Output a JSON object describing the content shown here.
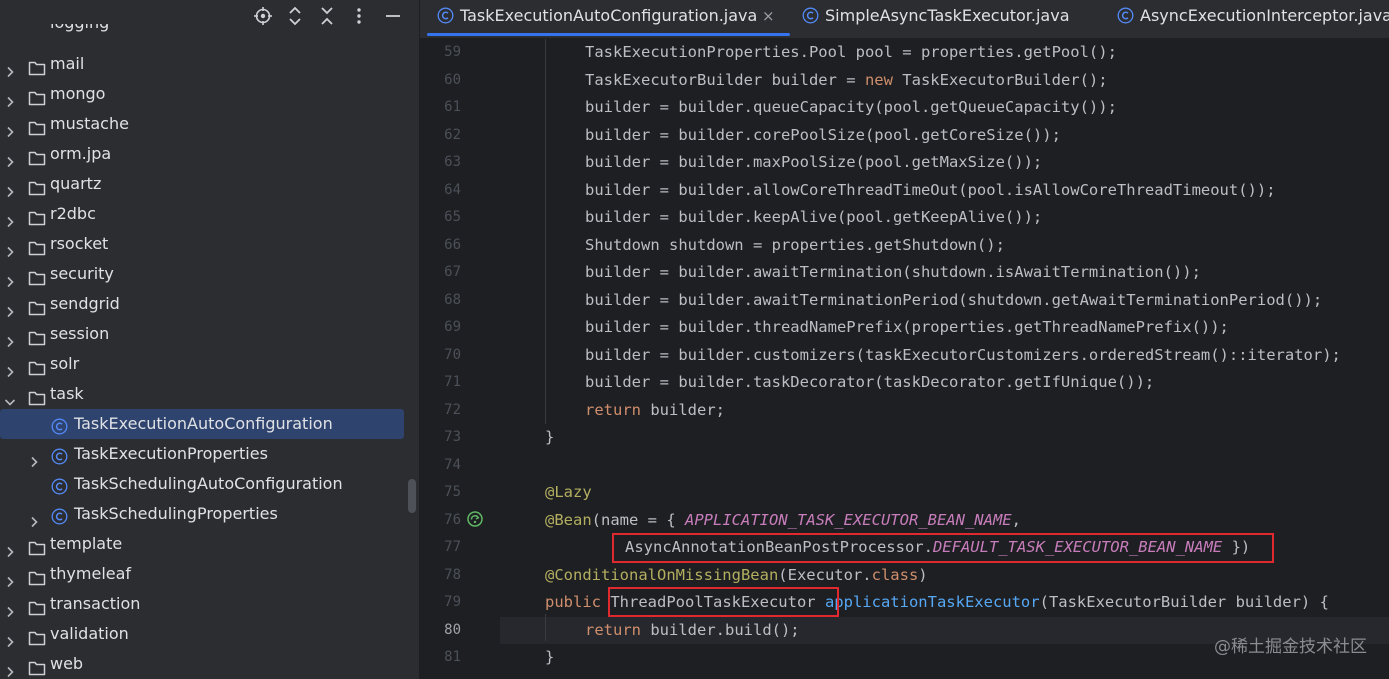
{
  "colors": {
    "panel_bg": "#2b2d30",
    "editor_bg": "#1e1f22",
    "selection_bg": "#2e436e",
    "tab_underline": "#3574f0",
    "keyword": "#cf8e6d",
    "annotation": "#b3ae60",
    "method": "#56a8f5",
    "constant": "#c77dbb",
    "highlight_box": "#e0282f"
  },
  "project_toolbar": {
    "icons": [
      "locate-icon",
      "expand-collapse-icon",
      "collapse-all-icon",
      "more-options-icon",
      "hide-icon"
    ]
  },
  "project_tree": {
    "partial_item": "logging",
    "items": [
      {
        "label": "mail",
        "type": "folder",
        "expanded": false
      },
      {
        "label": "mongo",
        "type": "folder",
        "expanded": false
      },
      {
        "label": "mustache",
        "type": "folder",
        "expanded": false
      },
      {
        "label": "orm.jpa",
        "type": "folder",
        "expanded": false
      },
      {
        "label": "quartz",
        "type": "folder",
        "expanded": false
      },
      {
        "label": "r2dbc",
        "type": "folder",
        "expanded": false
      },
      {
        "label": "rsocket",
        "type": "folder",
        "expanded": false
      },
      {
        "label": "security",
        "type": "folder",
        "expanded": false
      },
      {
        "label": "sendgrid",
        "type": "folder",
        "expanded": false
      },
      {
        "label": "session",
        "type": "folder",
        "expanded": false
      },
      {
        "label": "solr",
        "type": "folder",
        "expanded": false
      },
      {
        "label": "task",
        "type": "folder",
        "expanded": true
      },
      {
        "label": "TaskExecutionAutoConfiguration",
        "type": "class",
        "selected": true,
        "has_children": false
      },
      {
        "label": "TaskExecutionProperties",
        "type": "class",
        "has_children": true
      },
      {
        "label": "TaskSchedulingAutoConfiguration",
        "type": "class",
        "has_children": false
      },
      {
        "label": "TaskSchedulingProperties",
        "type": "class",
        "has_children": true
      },
      {
        "label": "template",
        "type": "folder",
        "expanded": false
      },
      {
        "label": "thymeleaf",
        "type": "folder",
        "expanded": false
      },
      {
        "label": "transaction",
        "type": "folder",
        "expanded": false
      },
      {
        "label": "validation",
        "type": "folder",
        "expanded": false
      },
      {
        "label": "web",
        "type": "folder",
        "expanded": false
      }
    ]
  },
  "tabs": [
    {
      "label": "TaskExecutionAutoConfiguration.java",
      "active": true,
      "close": "×"
    },
    {
      "label": "SimpleAsyncTaskExecutor.java",
      "active": false
    },
    {
      "label": "AsyncExecutionInterceptor.java",
      "active": false
    }
  ],
  "editor": {
    "current_line": 80,
    "lines": [
      {
        "n": "59",
        "t": [
          [
            "",
            "TaskExecutionProperties.Pool pool = properties.getPool();"
          ]
        ]
      },
      {
        "n": "60",
        "t": [
          [
            "",
            "TaskExecutorBuilder builder = "
          ],
          [
            "k",
            "new"
          ],
          [
            "",
            " TaskExecutorBuilder();"
          ]
        ]
      },
      {
        "n": "61",
        "t": [
          [
            "",
            "builder = builder.queueCapacity(pool.getQueueCapacity());"
          ]
        ]
      },
      {
        "n": "62",
        "t": [
          [
            "",
            "builder = builder.corePoolSize(pool.getCoreSize());"
          ]
        ]
      },
      {
        "n": "63",
        "t": [
          [
            "",
            "builder = builder.maxPoolSize(pool.getMaxSize());"
          ]
        ]
      },
      {
        "n": "64",
        "t": [
          [
            "",
            "builder = builder.allowCoreThreadTimeOut(pool.isAllowCoreThreadTimeout());"
          ]
        ]
      },
      {
        "n": "65",
        "t": [
          [
            "",
            "builder = builder.keepAlive(pool.getKeepAlive());"
          ]
        ]
      },
      {
        "n": "66",
        "t": [
          [
            "",
            "Shutdown shutdown = properties.getShutdown();"
          ]
        ]
      },
      {
        "n": "67",
        "t": [
          [
            "",
            "builder = builder.awaitTermination(shutdown.isAwaitTermination());"
          ]
        ]
      },
      {
        "n": "68",
        "t": [
          [
            "",
            "builder = builder.awaitTerminationPeriod(shutdown.getAwaitTerminationPeriod());"
          ]
        ]
      },
      {
        "n": "69",
        "t": [
          [
            "",
            "builder = builder.threadNamePrefix(properties.getThreadNamePrefix());"
          ]
        ]
      },
      {
        "n": "70",
        "t": [
          [
            "",
            "builder = builder.customizers(taskExecutorCustomizers.orderedStream()::iterator);"
          ]
        ]
      },
      {
        "n": "71",
        "t": [
          [
            "",
            "builder = builder.taskDecorator(taskDecorator.getIfUnique());"
          ]
        ]
      },
      {
        "n": "72",
        "t": [
          [
            "k",
            "return"
          ],
          [
            "",
            " builder;"
          ]
        ]
      },
      {
        "n": "73",
        "t": [
          [
            "",
            "}"
          ]
        ]
      },
      {
        "n": "74",
        "t": []
      },
      {
        "n": "75",
        "t": [
          [
            "a",
            "@Lazy"
          ]
        ]
      },
      {
        "n": "76",
        "t": [
          [
            "a",
            "@Bean"
          ],
          [
            "",
            "(name = { "
          ],
          [
            "c",
            "APPLICATION_TASK_EXECUTOR_BEAN_NAME"
          ],
          [
            "",
            ","
          ]
        ]
      },
      {
        "n": "77",
        "t": [
          [
            "",
            "AsyncAnnotationBeanPostProcessor."
          ],
          [
            "c",
            "DEFAULT_TASK_EXECUTOR_BEAN_NAME"
          ],
          [
            "",
            " })"
          ]
        ]
      },
      {
        "n": "78",
        "t": [
          [
            "a",
            "@ConditionalOnMissingBean"
          ],
          [
            "",
            "(Executor."
          ],
          [
            "k",
            "class"
          ],
          [
            "",
            ")"
          ]
        ]
      },
      {
        "n": "79",
        "t": [
          [
            "k",
            "public"
          ],
          [
            "",
            " ThreadPoolTaskExecutor "
          ],
          [
            "m",
            "applicationTaskExecutor"
          ],
          [
            "",
            "(TaskExecutorBuilder builder) {"
          ]
        ]
      },
      {
        "n": "80",
        "t": [
          [
            "k",
            "return"
          ],
          [
            "",
            " builder.build();"
          ]
        ]
      },
      {
        "n": "81",
        "t": [
          [
            "",
            "}"
          ]
        ]
      }
    ]
  },
  "watermark": "@稀土掘金技术社区"
}
